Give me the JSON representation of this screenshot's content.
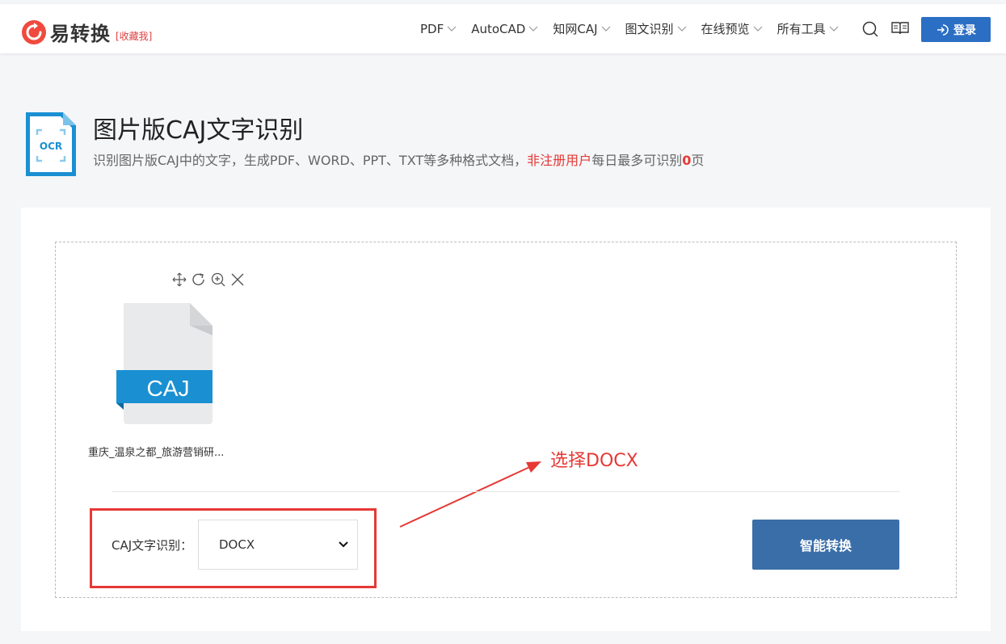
{
  "header": {
    "logo_text": "易转换",
    "favorite_label": "[收藏我]",
    "nav": [
      {
        "label": "PDF"
      },
      {
        "label": "AutoCAD"
      },
      {
        "label": "知网CAJ"
      },
      {
        "label": "图文识别"
      },
      {
        "label": "在线预览"
      },
      {
        "label": "所有工具"
      }
    ],
    "login_label": "登录"
  },
  "page": {
    "title": "图片版CAJ文字识别",
    "icon_text": "OCR",
    "desc_prefix": "识别图片版CAJ中的文字，生成PDF、WORD、PPT、TXT等多种格式文档，",
    "desc_highlight": "非注册用户",
    "desc_mid": "每日最多可识别",
    "desc_count": "0",
    "desc_suffix": "页"
  },
  "upload": {
    "file_type": "CAJ",
    "file_name": "重庆_温泉之都_旅游营销研..."
  },
  "annotation": {
    "text": "选择DOCX"
  },
  "form": {
    "format_label": "CAJ文字识别：",
    "format_value": "DOCX",
    "convert_label": "智能转换"
  },
  "colors": {
    "brand_red": "#f04a3e",
    "primary_blue": "#2b6fc5",
    "convert_blue": "#3a6ea8",
    "caj_blue": "#1a90d2",
    "annotation_red": "#e53935"
  }
}
